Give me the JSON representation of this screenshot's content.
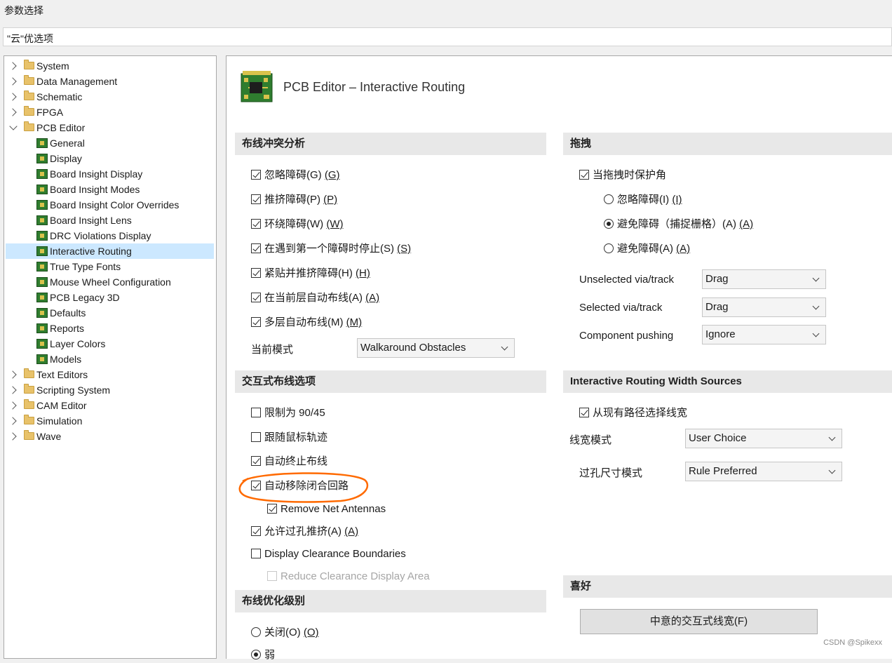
{
  "window": {
    "title": "参数选择"
  },
  "tabbar": {
    "label": "\"云\"优选项"
  },
  "tree": {
    "items": [
      {
        "label": "System",
        "type": "folder",
        "expand": "collapsed"
      },
      {
        "label": "Data Management",
        "type": "folder",
        "expand": "collapsed"
      },
      {
        "label": "Schematic",
        "type": "folder",
        "expand": "collapsed"
      },
      {
        "label": "FPGA",
        "type": "folder",
        "expand": "collapsed"
      },
      {
        "label": "PCB Editor",
        "type": "folder",
        "expand": "expanded"
      },
      {
        "label": "General",
        "type": "page"
      },
      {
        "label": "Display",
        "type": "page"
      },
      {
        "label": "Board Insight Display",
        "type": "page"
      },
      {
        "label": "Board Insight Modes",
        "type": "page"
      },
      {
        "label": "Board Insight Color Overrides",
        "type": "page"
      },
      {
        "label": "Board Insight Lens",
        "type": "page"
      },
      {
        "label": "DRC Violations Display",
        "type": "page"
      },
      {
        "label": "Interactive Routing",
        "type": "page",
        "selected": true
      },
      {
        "label": "True Type Fonts",
        "type": "page"
      },
      {
        "label": "Mouse Wheel Configuration",
        "type": "page"
      },
      {
        "label": "PCB Legacy 3D",
        "type": "page"
      },
      {
        "label": "Defaults",
        "type": "page"
      },
      {
        "label": "Reports",
        "type": "page"
      },
      {
        "label": "Layer Colors",
        "type": "page"
      },
      {
        "label": "Models",
        "type": "page"
      },
      {
        "label": "Text Editors",
        "type": "folder",
        "expand": "collapsed"
      },
      {
        "label": "Scripting System",
        "type": "folder",
        "expand": "collapsed"
      },
      {
        "label": "CAM Editor",
        "type": "folder",
        "expand": "collapsed"
      },
      {
        "label": "Simulation",
        "type": "folder",
        "expand": "collapsed"
      },
      {
        "label": "Wave",
        "type": "folder",
        "expand": "collapsed"
      }
    ]
  },
  "page": {
    "title": "PCB Editor – Interactive Routing"
  },
  "conflict": {
    "header": "布线冲突分析",
    "options": [
      {
        "text": "忽略障碍(G)",
        "key": "(G)",
        "checked": true
      },
      {
        "text": "推挤障碍(P)",
        "key": "(P)",
        "checked": true
      },
      {
        "text": "环绕障碍(W)",
        "key": "(W)",
        "checked": true
      },
      {
        "text": "在遇到第一个障碍时停止(S)",
        "key": "(S)",
        "checked": true
      },
      {
        "text": "紧贴并推挤障碍(H)",
        "key": "(H)",
        "checked": true
      },
      {
        "text": "在当前层自动布线(A)",
        "key": "(A)",
        "checked": true
      },
      {
        "text": "多层自动布线(M)",
        "key": "(M)",
        "checked": true
      }
    ],
    "mode_label": "当前模式",
    "mode_value": "Walkaround Obstacles"
  },
  "interactive": {
    "header": "交互式布线选项",
    "options": [
      {
        "text": "限制为 90/45",
        "key": "",
        "checked": false
      },
      {
        "text": "跟随鼠标轨迹",
        "key": "",
        "checked": false
      },
      {
        "text": "自动终止布线",
        "key": "",
        "checked": true
      },
      {
        "text": "自动移除闭合回路",
        "key": "",
        "checked": true
      },
      {
        "text": "Remove Net Antennas",
        "key": "",
        "checked": true
      },
      {
        "text": "允许过孔推挤(A)",
        "key": "(A)",
        "checked": true
      },
      {
        "text": "Display Clearance Boundaries",
        "key": "",
        "checked": false
      },
      {
        "text": "Reduce Clearance Display Area",
        "key": "",
        "checked": false,
        "disabled": true
      }
    ]
  },
  "optimize": {
    "header": "布线优化级别",
    "options": [
      {
        "text": "关闭(O)",
        "key": "(O)",
        "selected": false
      },
      {
        "text": "弱",
        "key": "",
        "selected": true
      }
    ]
  },
  "drag": {
    "header": "拖拽",
    "preserve": {
      "text": "当拖拽时保护角",
      "checked": true
    },
    "radios": [
      {
        "text": "忽略障碍(I)",
        "key": "(I)",
        "selected": false
      },
      {
        "text": "避免障碍（捕捉栅格）(A)",
        "key": "(A)",
        "selected": true
      },
      {
        "text": "避免障碍(A)",
        "key": "(A)",
        "selected": false
      }
    ],
    "unselected_label": "Unselected via/track",
    "unselected_value": "Drag",
    "selected_label": "Selected via/track",
    "selected_value": "Drag",
    "component_label": "Component pushing",
    "component_value": "Ignore"
  },
  "width": {
    "header": "Interactive Routing Width Sources",
    "pick": {
      "text": "从现有路径选择线宽",
      "checked": true
    },
    "width_mode_label": "线宽模式",
    "width_mode_value": "User Choice",
    "via_mode_label": "过孔尺寸模式",
    "via_mode_value": "Rule Preferred"
  },
  "prefs": {
    "header": "喜好",
    "button": "中意的交互式线宽(F)",
    "button_key": "(F)"
  },
  "watermark": "CSDN @Spikexx",
  "colors": {
    "selection": "#cce8ff",
    "highlight_circle": "#ff6a00",
    "section_bg": "#e8e8e8"
  }
}
